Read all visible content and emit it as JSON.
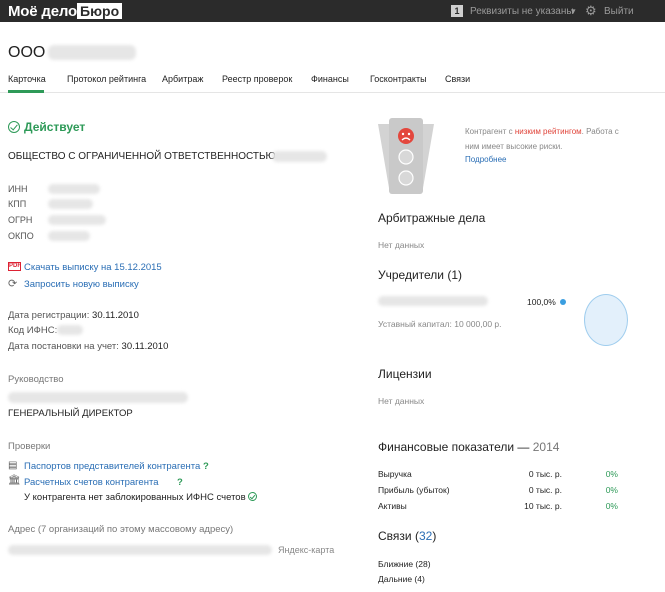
{
  "topbar": {
    "logo_text": "Моё дело",
    "logo_box": "Бюро",
    "requisites_count": "1",
    "requisites_label": "Реквизиты не указаны",
    "logout": "Выйти"
  },
  "company": {
    "short_prefix": "ООО"
  },
  "tabs": [
    {
      "label": "Карточка"
    },
    {
      "label": "Протокол рейтинга"
    },
    {
      "label": "Арбитраж"
    },
    {
      "label": "Реестр проверок"
    },
    {
      "label": "Финансы"
    },
    {
      "label": "Госконтракты"
    },
    {
      "label": "Связи"
    }
  ],
  "card": {
    "status": "Действует",
    "full_name_prefix": "ОБЩЕСТВО С ОГРАНИЧЕННОЙ ОТВЕТСТВЕННОСТЬЮ",
    "requisites": [
      {
        "label": "ИНН"
      },
      {
        "label": "КПП"
      },
      {
        "label": "ОГРН"
      },
      {
        "label": "ОКПО"
      }
    ],
    "pdf_icon": "PDF",
    "download_prefix": "Скачать выписку на ",
    "download_date": "15.12.2015",
    "request_new": "Запросить новую выписку",
    "registration_label": "Дата регистрации:",
    "registration_date": "30.11.2010",
    "ifns_label": "Код ИФНС:",
    "tax_reg_label": "Дата постановки на учет:",
    "tax_reg_date": "30.11.2010",
    "management_header": "Руководство",
    "director_title": "ГЕНЕРАЛЬНЫЙ ДИРЕКТОР",
    "checks_header": "Проверки",
    "check_passports": "Паспортов представителей контрагента",
    "check_accounts": "Расчетных счетов контрагента",
    "question_mark": "?",
    "blocked_accounts": "У контрагента нет заблокированных ИФНС счетов",
    "address_header": "Адрес (7 организаций по этому массовому адресу)",
    "yandex_map": "Яндекс-карта"
  },
  "risk": {
    "text_before": "Контрагент с ",
    "text_highlight": "низким рейтингом",
    "text_after": ". Работа с ним имеет высокие риски.",
    "more": "Подробнее"
  },
  "arbitration": {
    "title": "Арбитражные дела",
    "value": "Нет данных"
  },
  "founders": {
    "title": "Учредители (1)",
    "share": "100,0%",
    "capital": "Уставный капитал: 10 000,00 р."
  },
  "licenses": {
    "title": "Лицензии",
    "value": "Нет данных"
  },
  "finance": {
    "title": "Финансовые показатели — ",
    "year": "2014",
    "rows": [
      {
        "label": "Выручка",
        "value": "0 тыс. р.",
        "pct": "0%"
      },
      {
        "label": "Прибыль (убыток)",
        "value": "0 тыс. р.",
        "pct": "0%"
      },
      {
        "label": "Активы",
        "value": "10 тыс. р.",
        "pct": "0%"
      }
    ]
  },
  "links": {
    "title": "Связи (",
    "count": "32",
    "title_close": ")",
    "near": "Ближние (28)",
    "far": "Дальние (4)"
  },
  "colors": {
    "accent_green": "#2e9a58",
    "link_blue": "#2a6eb5",
    "danger_red": "#e0443a",
    "topbar_bg": "#2b2b2b"
  }
}
